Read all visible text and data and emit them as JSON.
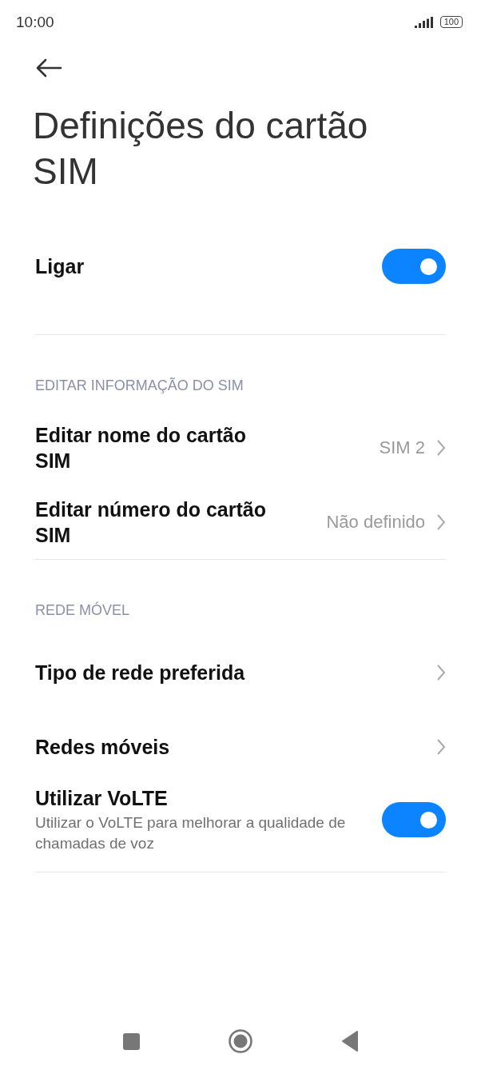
{
  "status_bar": {
    "time": "10:00",
    "battery": "100"
  },
  "title": "Definições do cartão SIM",
  "sections": [
    {
      "items": [
        {
          "kind": "toggle",
          "label": "Ligar",
          "on": true
        }
      ]
    },
    {
      "header": "EDITAR INFORMAÇÃO DO SIM",
      "items": [
        {
          "kind": "link",
          "label": "Editar nome do cartão SIM",
          "value": "SIM 2"
        },
        {
          "kind": "link",
          "label": "Editar número do cartão SIM",
          "value": "Não definido"
        }
      ]
    },
    {
      "header": "REDE MÓVEL",
      "items": [
        {
          "kind": "link",
          "label": "Tipo de rede preferida"
        },
        {
          "kind": "link",
          "label": "Redes móveis"
        },
        {
          "kind": "toggle",
          "label": "Utilizar VoLTE",
          "description": "Utilizar o VoLTE para melhorar a qualidade de chamadas de voz",
          "on": true
        }
      ]
    }
  ]
}
